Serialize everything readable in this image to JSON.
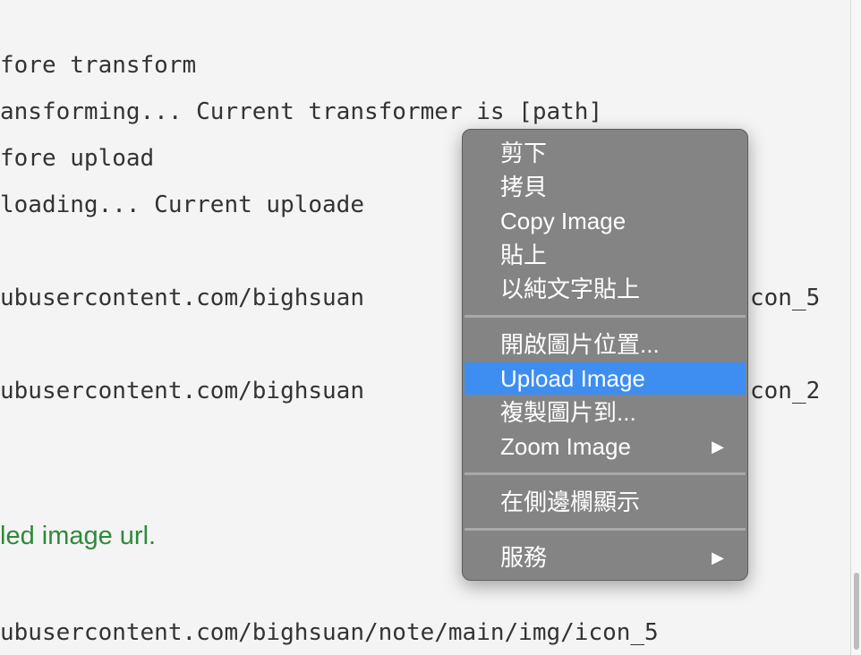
{
  "log": {
    "line1": "fore transform",
    "line2": "ansforming... Current transformer is [path]",
    "line3": "fore upload",
    "line4": "loading... Current uploade",
    "line5": "ubusercontent.com/bighsuan",
    "line5_tail": "con_5",
    "line6": "ubusercontent.com/bighsuan",
    "line6_tail": "con_2",
    "status": "led image url.",
    "line7": "ubusercontent.com/bighsuan/note/main/img/icon_5"
  },
  "context_menu": {
    "items": [
      {
        "label": "剪下"
      },
      {
        "label": "拷貝"
      },
      {
        "label": "Copy Image"
      },
      {
        "label": "貼上"
      },
      {
        "label": "以純文字貼上"
      },
      {
        "label": "開啟圖片位置..."
      },
      {
        "label": "Upload Image",
        "highlighted": true
      },
      {
        "label": "複製圖片到..."
      },
      {
        "label": "Zoom Image",
        "submenu": true
      },
      {
        "label": "在側邊欄顯示"
      },
      {
        "label": "服務",
        "submenu": true
      }
    ],
    "submenu_arrow": "▶",
    "highlight_color": "#3d8ef0"
  },
  "colors": {
    "status_green": "#2d8a39",
    "menu_background": "#808080"
  }
}
